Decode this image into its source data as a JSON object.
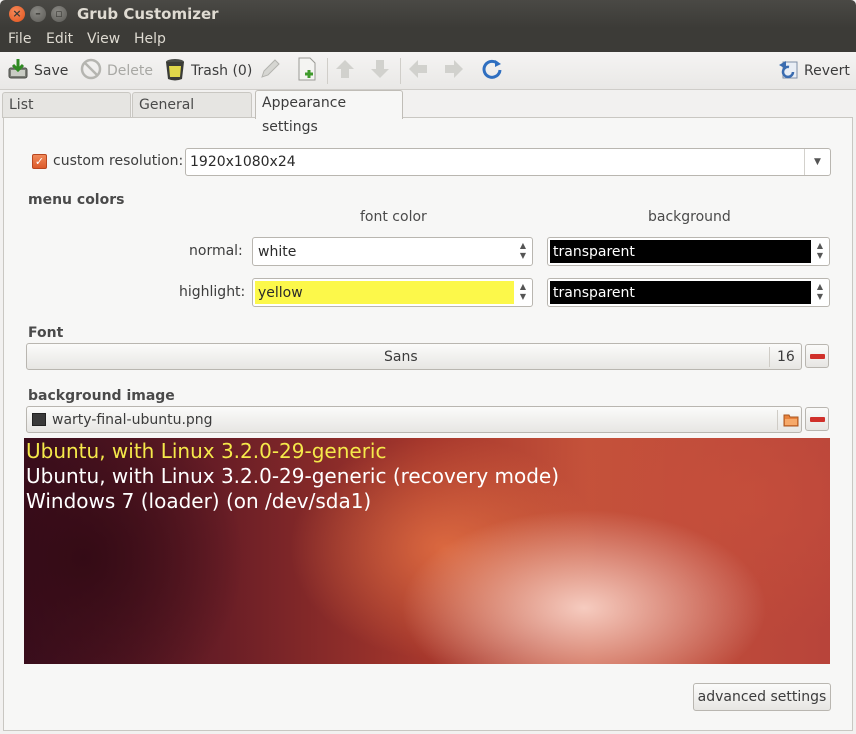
{
  "window": {
    "title": "Grub Customizer"
  },
  "menubar": {
    "items": [
      "File",
      "Edit",
      "View",
      "Help"
    ]
  },
  "toolbar": {
    "save": "Save",
    "delete": "Delete",
    "trash": "Trash (0)",
    "revert": "Revert"
  },
  "tabs": [
    "List configuration",
    "General settings",
    "Appearance settings"
  ],
  "resolution": {
    "checkbox_label": "custom resolution:",
    "checked": true,
    "value": "1920x1080x24"
  },
  "menu_colors": {
    "section_label": "menu colors",
    "font_color_header": "font color",
    "background_header": "background",
    "normal_label": "normal:",
    "normal_font": "white",
    "normal_bg": "transparent",
    "highlight_label": "highlight:",
    "highlight_font": "yellow",
    "highlight_bg": "transparent"
  },
  "font": {
    "section_label": "Font",
    "name": "Sans",
    "size": "16"
  },
  "background_image": {
    "section_label": "background image",
    "file": "warty-final-ubuntu.png"
  },
  "preview": {
    "entries": [
      "Ubuntu, with Linux 3.2.0-29-generic",
      "Ubuntu, with Linux 3.2.0-29-generic (recovery mode)",
      "Windows 7 (loader) (on /dev/sda1)"
    ],
    "highlight_color": "#f5e94a",
    "normal_color": "#ffffff"
  },
  "advanced_button": "advanced settings",
  "colors": {
    "accent": "#dd5a2a",
    "titlebar": "#3c3b37"
  }
}
